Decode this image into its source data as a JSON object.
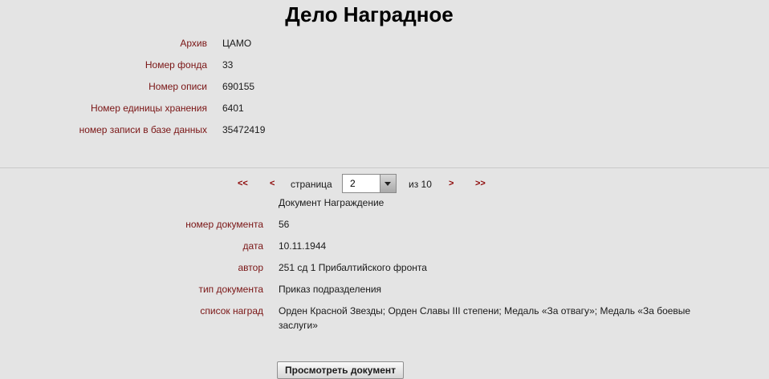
{
  "title": "Дело Наградное",
  "archive_info": [
    {
      "label": "Архив",
      "value": "ЦАМО"
    },
    {
      "label": "Номер фонда",
      "value": "33"
    },
    {
      "label": "Номер описи",
      "value": "690155"
    },
    {
      "label": "Номер единицы хранения",
      "value": "6401"
    },
    {
      "label": "номер записи в базе данных",
      "value": "35472419"
    }
  ],
  "pager": {
    "first": "<<",
    "prev": "<",
    "page_label": "страница",
    "current_page": "2",
    "total_label": "из 10",
    "next": ">",
    "last": ">>"
  },
  "document": {
    "heading": "Документ Награждение",
    "fields": [
      {
        "label": "номер документа",
        "value": "56"
      },
      {
        "label": "дата",
        "value": "10.11.1944"
      },
      {
        "label": "автор",
        "value": "251 сд 1 Прибалтийского фронта"
      },
      {
        "label": "тип документа",
        "value": "Приказ подразделения"
      },
      {
        "label": "список наград",
        "value": "Орден Красной Звезды; Орден Славы III степени; Медаль «За отвагу»; Медаль «За боевые заслуги»"
      }
    ]
  },
  "actions": {
    "view_document": "Просмотреть документ"
  },
  "colors": {
    "label": "#7a1515",
    "nav": "#8b0000",
    "background": "#e4e4e4"
  }
}
